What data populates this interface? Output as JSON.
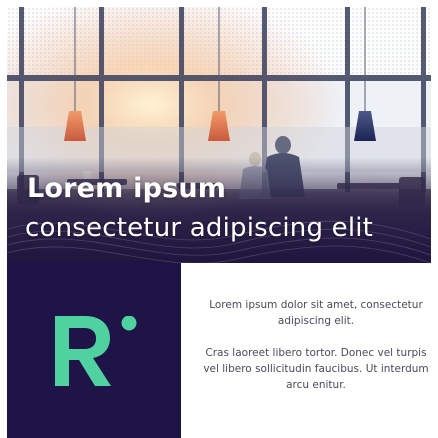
{
  "hero": {
    "title": "Lorem ipsum",
    "subtitle": "consectetur adipiscing elit"
  },
  "brand": {
    "logo_letter": "R",
    "logo_color": "#4fd1a0",
    "panel_color": "#1e1447"
  },
  "body": {
    "paragraph_1": "Lorem ipsum dolor sit amet, consectetur adipiscing elit.",
    "paragraph_2": "Cras laoreet libero tortor. Donec vel turpis vel libero sollicitudin faucibus. Ut interdum arcu enitur."
  }
}
